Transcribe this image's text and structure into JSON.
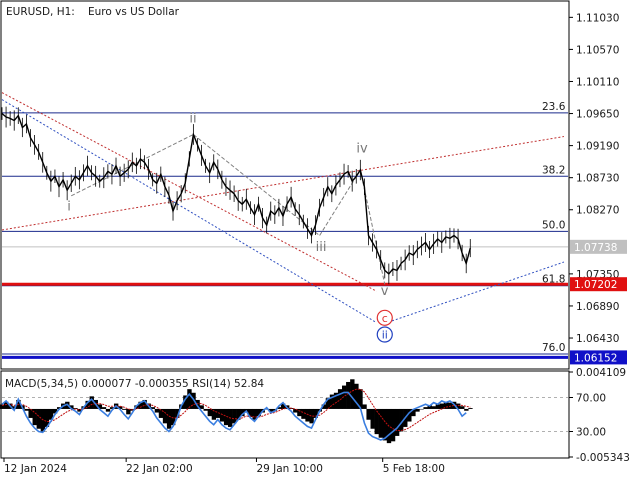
{
  "header": {
    "symbol": "EURUSD, H1:",
    "description": "Euro vs US Dollar"
  },
  "colors": {
    "price_line": "#000000",
    "fib_line": "#1a2a8c",
    "current_price_bg": "#c0c0c0",
    "support_red": "#e01010",
    "support_blue": "#1010c8",
    "trend_red": "#c03030",
    "trend_blue": "#3050c0",
    "wave_grey": "#808080",
    "macd_hist": "#000000",
    "macd_signal": "#c01010",
    "rsi_line": "#3a7ee0",
    "circle_red": "#e03030",
    "circle_blue": "#2040c0"
  },
  "chart_data": [
    {
      "type": "line",
      "subtype": "price",
      "y_ticks": [
        "1.11030",
        "1.10570",
        "1.10110",
        "1.09650",
        "1.09190",
        "1.08730",
        "1.08270",
        "1.07350",
        "1.06890",
        "1.06430"
      ],
      "ylim": [
        1.06,
        1.1125
      ],
      "x_ticks": [
        "12 Jan 2024",
        "22 Jan 02:00",
        "29 Jan 10:00",
        "5 Feb 18:00"
      ],
      "current_price": "1.07738",
      "current_price_value": 1.07738,
      "fib_levels": [
        {
          "label": "23.6",
          "value": 1.0966
        },
        {
          "label": "38.2",
          "value": 1.0875
        },
        {
          "label": "50.0",
          "value": 1.0796
        },
        {
          "label": "61.8",
          "value": 1.0718
        },
        {
          "label": "76.0",
          "value": 1.062
        }
      ],
      "support_levels": [
        {
          "label": "1.07202",
          "value": 1.07202,
          "color_key": "support_red"
        },
        {
          "label": "1.06152",
          "value": 1.06152,
          "color_key": "support_blue"
        }
      ],
      "wave_labels": [
        {
          "text": "i",
          "bar": 17,
          "price": 1.0826
        },
        {
          "text": "ii",
          "bar": 47,
          "price": 1.0952
        },
        {
          "text": "iii",
          "bar": 78,
          "price": 1.0768
        },
        {
          "text": "iv",
          "bar": 88,
          "price": 1.0909
        },
        {
          "text": "v",
          "bar": 94,
          "price": 1.0705
        }
      ],
      "circle_labels": [
        {
          "text": "c",
          "bar": 94,
          "price": 1.0672,
          "color_key": "circle_red"
        },
        {
          "text": "ii",
          "bar": 94,
          "price": 1.0648,
          "color_key": "circle_blue"
        }
      ],
      "price_series": [
        1.0965,
        1.096,
        1.0958,
        1.0955,
        1.0962,
        1.0945,
        1.095,
        1.093,
        1.092,
        1.091,
        1.0895,
        1.088,
        1.0868,
        1.0875,
        1.086,
        1.087,
        1.0855,
        1.0865,
        1.0875,
        1.087,
        1.088,
        1.089,
        1.088,
        1.0875,
        1.0868,
        1.0873,
        1.0882,
        1.0878,
        1.089,
        1.0875,
        1.088,
        1.0885,
        1.0895,
        1.089,
        1.09,
        1.0895,
        1.0885,
        1.087,
        1.0865,
        1.0878,
        1.086,
        1.0848,
        1.0825,
        1.084,
        1.085,
        1.0865,
        1.09,
        1.0935,
        1.092,
        1.0905,
        1.089,
        1.088,
        1.0895,
        1.0885,
        1.087,
        1.086,
        1.0855,
        1.085,
        1.084,
        1.0835,
        1.0842,
        1.083,
        1.082,
        1.0835,
        1.0815,
        1.0805,
        1.0825,
        1.082,
        1.083,
        1.0818,
        1.0835,
        1.0845,
        1.0828,
        1.082,
        1.081,
        1.08,
        1.079,
        1.0805,
        1.083,
        1.0845,
        1.086,
        1.085,
        1.0862,
        1.087,
        1.0878,
        1.0882,
        1.0868,
        1.0875,
        1.0884,
        1.086,
        1.079,
        1.078,
        1.077,
        1.0755,
        1.074,
        1.0735,
        1.0742,
        1.074,
        1.075,
        1.0755,
        1.0765,
        1.0762,
        1.077,
        1.0775,
        1.078,
        1.077,
        1.0778,
        1.0785,
        1.078,
        1.0788,
        1.0786,
        1.079,
        1.0785,
        1.0765,
        1.075,
        1.0772
      ],
      "trend_lines": [
        {
          "name": "red-dotted-upper",
          "color_key": "trend_red",
          "from": {
            "bar": 0,
            "price": 1.0798
          },
          "to": {
            "bar": 138,
            "price": 1.0932
          }
        },
        {
          "name": "red-dotted-diag",
          "color_key": "trend_red",
          "from": {
            "bar": 0,
            "price": 1.0995
          },
          "to": {
            "bar": 92,
            "price": 1.071
          }
        },
        {
          "name": "blue-dotted-diag",
          "color_key": "trend_blue",
          "from": {
            "bar": 0,
            "price": 1.0985
          },
          "to": {
            "bar": 92,
            "price": 1.0665
          }
        },
        {
          "name": "blue-dotted-up",
          "color_key": "trend_blue",
          "from": {
            "bar": 93,
            "price": 1.0662
          },
          "to": {
            "bar": 138,
            "price": 1.0752
          }
        },
        {
          "name": "grey-wave-1",
          "color_key": "wave_grey",
          "from": {
            "bar": 17,
            "price": 1.0847
          },
          "to": {
            "bar": 47,
            "price": 1.0935
          }
        },
        {
          "name": "grey-wave-2",
          "color_key": "wave_grey",
          "from": {
            "bar": 47,
            "price": 1.0935
          },
          "to": {
            "bar": 78,
            "price": 1.079
          }
        },
        {
          "name": "grey-wave-3",
          "color_key": "wave_grey",
          "from": {
            "bar": 78,
            "price": 1.079
          },
          "to": {
            "bar": 88,
            "price": 1.0884
          }
        },
        {
          "name": "grey-wave-4",
          "color_key": "wave_grey",
          "from": {
            "bar": 88,
            "price": 1.0884
          },
          "to": {
            "bar": 94,
            "price": 1.072
          }
        }
      ]
    },
    {
      "type": "bar",
      "subtype": "oscillator",
      "title": "MACD(5,34,5) 0.000077 -0.000355 RSI(14) 52.84",
      "y_ticks": [
        "0.004109",
        "70.00",
        "30.00",
        "-0.005343"
      ],
      "ylim": [
        -0.005343,
        0.004109
      ],
      "macd_hist": [
        0.0005,
        0.0008,
        0.0006,
        0.0003,
        0.001,
        0.0004,
        -0.0002,
        -0.001,
        -0.0018,
        -0.0022,
        -0.0025,
        -0.002,
        -0.0012,
        -0.0005,
        0.0002,
        0.0006,
        0.0008,
        0.0004,
        0.0001,
        -0.0003,
        0.0003,
        0.0009,
        0.0014,
        0.001,
        0.0005,
        0.0002,
        -0.0003,
        0.0002,
        0.0006,
        0.0003,
        -0.0001,
        -0.0006,
        -0.0002,
        0.0004,
        0.0008,
        0.001,
        0.0006,
        0.0002,
        -0.0004,
        -0.001,
        -0.0016,
        -0.0022,
        -0.0018,
        -0.001,
        0.0005,
        0.0015,
        0.0022,
        0.0018,
        0.001,
        0.0004,
        -0.0002,
        -0.0008,
        -0.0012,
        -0.001,
        -0.0014,
        -0.0018,
        -0.002,
        -0.0016,
        -0.0012,
        -0.0008,
        -0.0004,
        -0.0009,
        -0.0012,
        -0.0008,
        -0.0004,
        0.0,
        -0.0003,
        -0.0002,
        0.0002,
        0.0006,
        0.0004,
        0.0001,
        -0.0004,
        -0.0008,
        -0.0011,
        -0.0014,
        -0.0016,
        -0.001,
        -0.0003,
        0.0005,
        0.0012,
        0.0016,
        0.0018,
        0.0022,
        0.0026,
        0.003,
        0.0033,
        0.0028,
        0.0022,
        0.0005,
        -0.0012,
        -0.0022,
        -0.0028,
        -0.0032,
        -0.0035,
        -0.0038,
        -0.0036,
        -0.003,
        -0.0025,
        -0.002,
        -0.0014,
        -0.0008,
        -0.0003,
        0.0,
        0.0002,
        0.0004,
        0.0003,
        0.0005,
        0.0006,
        0.0008,
        0.0007,
        0.0008,
        0.0006,
        0.0003,
        -0.0002,
        0.0001
      ],
      "macd_signal": [
        0.0004,
        0.0005,
        0.0005,
        0.0004,
        0.0005,
        0.0005,
        0.0003,
        0.0,
        -0.0004,
        -0.0008,
        -0.0012,
        -0.0014,
        -0.0014,
        -0.0012,
        -0.0009,
        -0.0006,
        -0.0003,
        -0.0001,
        0.0,
        -0.0001,
        0.0,
        0.0002,
        0.0005,
        0.0006,
        0.0006,
        0.0005,
        0.0003,
        0.0003,
        0.0003,
        0.0003,
        0.0002,
        0.0,
        -0.0001,
        0.0,
        0.0002,
        0.0004,
        0.0005,
        0.0004,
        0.0002,
        -0.0001,
        -0.0004,
        -0.0008,
        -0.001,
        -0.001,
        -0.0007,
        -0.0003,
        0.0002,
        0.0005,
        0.0006,
        0.0006,
        0.0004,
        0.0001,
        -0.0002,
        -0.0004,
        -0.0006,
        -0.0008,
        -0.001,
        -0.0011,
        -0.0011,
        -0.001,
        -0.0008,
        -0.0008,
        -0.0009,
        -0.0009,
        -0.0008,
        -0.0006,
        -0.0005,
        -0.0004,
        -0.0002,
        0.0,
        0.0001,
        0.0001,
        0.0,
        -0.0002,
        -0.0004,
        -0.0006,
        -0.0008,
        -0.0008,
        -0.0007,
        -0.0004,
        0.0,
        0.0004,
        0.0007,
        0.001,
        0.0014,
        0.0017,
        0.002,
        0.0022,
        0.0022,
        0.0019,
        0.0012,
        0.0005,
        -0.0002,
        -0.0008,
        -0.0014,
        -0.0019,
        -0.0022,
        -0.0024,
        -0.0024,
        -0.0023,
        -0.0021,
        -0.0018,
        -0.0015,
        -0.0012,
        -0.0009,
        -0.0006,
        -0.0004,
        -0.0002,
        0.0,
        0.0002,
        0.0003,
        0.0004,
        0.0004,
        0.0004,
        0.0003,
        0.0002
      ],
      "rsi": [
        62,
        66,
        60,
        55,
        68,
        58,
        48,
        40,
        34,
        30,
        29,
        35,
        42,
        50,
        56,
        60,
        62,
        57,
        54,
        50,
        58,
        64,
        68,
        62,
        56,
        52,
        48,
        55,
        60,
        56,
        50,
        45,
        52,
        60,
        64,
        66,
        60,
        54,
        46,
        40,
        34,
        30,
        36,
        46,
        60,
        68,
        74,
        68,
        60,
        54,
        48,
        42,
        38,
        44,
        38,
        34,
        32,
        38,
        44,
        50,
        54,
        46,
        42,
        48,
        54,
        58,
        52,
        54,
        60,
        64,
        58,
        54,
        48,
        44,
        40,
        36,
        34,
        44,
        54,
        62,
        68,
        70,
        72,
        74,
        76,
        76,
        70,
        64,
        58,
        40,
        28,
        24,
        22,
        20,
        22,
        26,
        30,
        34,
        40,
        46,
        52,
        56,
        58,
        60,
        62,
        60,
        64,
        62,
        66,
        64,
        66,
        62,
        56,
        48,
        52
      ],
      "rsi_levels": [
        70,
        30
      ]
    }
  ]
}
